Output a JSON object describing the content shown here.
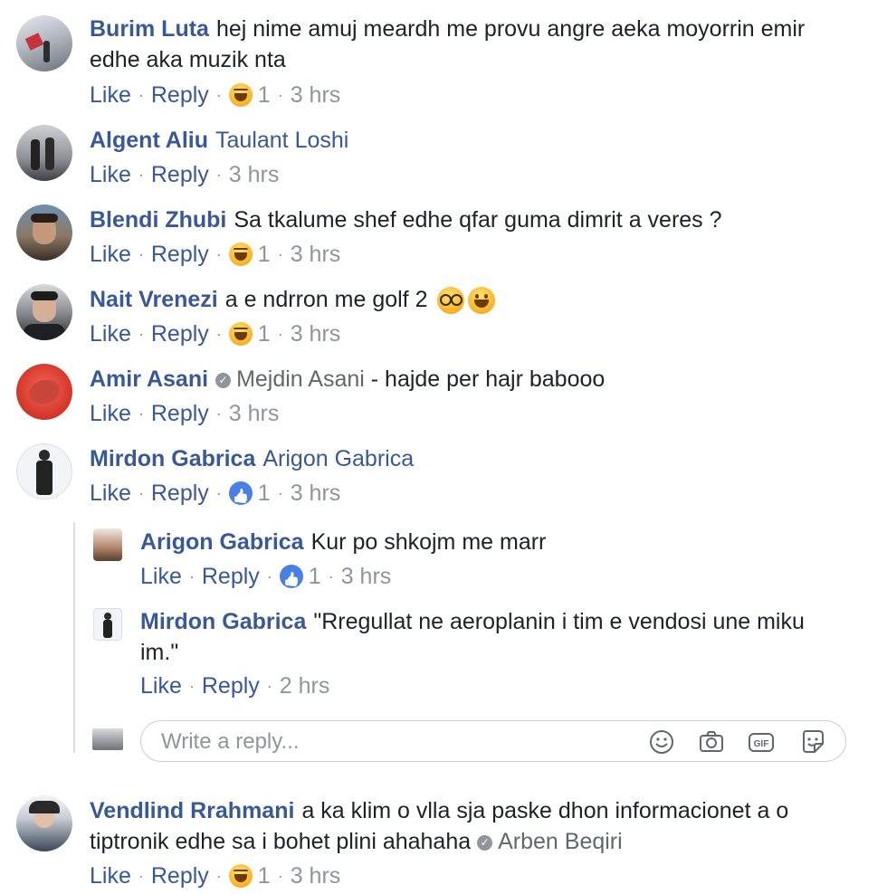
{
  "comments": [
    {
      "author": "Burim Luta",
      "text": "hej nime amuj meardh me provu angre aeka moyorrin emir edhe aka muzik nta",
      "like": "Like",
      "reply": "Reply",
      "reaction": "haha",
      "count": "1",
      "time": "3 hrs"
    },
    {
      "author": "Algent Aliu",
      "tag": "Taulant Loshi",
      "like": "Like",
      "reply": "Reply",
      "time": "3 hrs"
    },
    {
      "author": "Blendi Zhubi",
      "text": "Sa tkalume shef edhe qfar guma dimrit a veres ?",
      "like": "Like",
      "reply": "Reply",
      "reaction": "haha",
      "count": "1",
      "time": "3 hrs"
    },
    {
      "author": "Nait Vrenezi",
      "text": "a e ndrron me golf 2",
      "emojis": [
        "nerd-face-emoji",
        "smiling-face-emoji"
      ],
      "like": "Like",
      "reply": "Reply",
      "reaction": "haha",
      "count": "1",
      "time": "3 hrs"
    },
    {
      "author": "Amir Asani",
      "mention": "Mejdin Asani",
      "text": "- hajde per hajr babooo",
      "like": "Like",
      "reply": "Reply",
      "time": "3 hrs"
    },
    {
      "author": "Mirdon Gabrica",
      "tag": "Arigon Gabrica",
      "like": "Like",
      "reply": "Reply",
      "reaction": "like",
      "count": "1",
      "time": "3 hrs"
    }
  ],
  "replies": [
    {
      "author": "Arigon Gabrica",
      "text": "Kur po shkojm me marr",
      "like": "Like",
      "reply": "Reply",
      "reaction": "like",
      "count": "1",
      "time": "3 hrs"
    },
    {
      "author": "Mirdon Gabrica",
      "text": "\"Rregullat ne aeroplanin i tim e vendosi une miku im.\"",
      "like": "Like",
      "reply": "Reply",
      "time": "2 hrs"
    }
  ],
  "reply_box": {
    "placeholder": "Write a reply...",
    "icons": [
      "emoji-icon",
      "camera-icon",
      "gif-icon",
      "sticker-icon"
    ],
    "gif_label": "GIF"
  },
  "last_comment": {
    "author": "Vendlind Rrahmani",
    "text": "a ka klim o vlla sja paske dhon informacionet a o tiptronik edhe sa i bohet plini ahahaha",
    "mention": "Arben Beqiri",
    "like": "Like",
    "reply": "Reply",
    "reaction": "haha",
    "count": "1",
    "time": "3 hrs"
  },
  "colors": {
    "link": "#385898",
    "meta": "#90949c",
    "text": "#1d2129",
    "like_reaction": "#4a7fe6",
    "haha_reaction": "#f7b125"
  },
  "separator": "·"
}
